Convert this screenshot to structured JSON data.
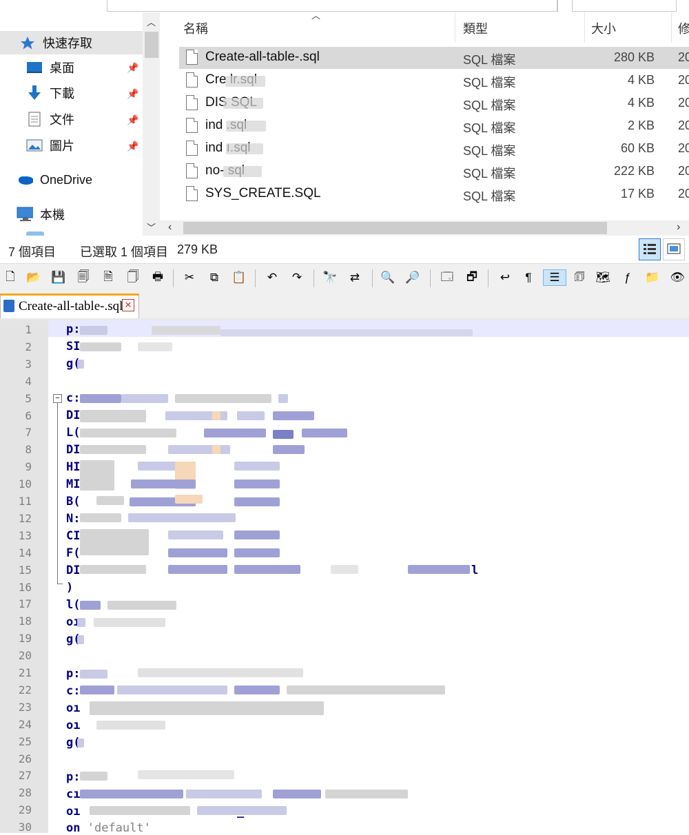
{
  "explorer": {
    "nav": {
      "items": [
        {
          "label": "快速存取",
          "icon": "quick-access-star-icon",
          "pinned": false
        },
        {
          "label": "桌面",
          "icon": "desktop-icon",
          "pinned": true
        },
        {
          "label": "下載",
          "icon": "download-arrow-icon",
          "pinned": true
        },
        {
          "label": "文件",
          "icon": "documents-icon",
          "pinned": true
        },
        {
          "label": "圖片",
          "icon": "pictures-icon",
          "pinned": true
        },
        {
          "label": "OneDrive",
          "icon": "onedrive-cloud-icon",
          "pinned": false
        },
        {
          "label": "本機",
          "icon": "this-pc-icon",
          "pinned": false
        }
      ]
    },
    "columns": {
      "name": "名稱",
      "type": "類型",
      "size": "大小",
      "modified": "修"
    },
    "files": [
      {
        "name": "Create-all-table-.sql",
        "type": "SQL 檔案",
        "size": "280 KB",
        "modified": "20",
        "selected": true
      },
      {
        "name": "Cre        lr.sql",
        "type": "SQL 檔案",
        "size": "4 KB",
        "modified": "20",
        "selected": false
      },
      {
        "name": "DIS        SQL",
        "type": "SQL 檔案",
        "size": "4 KB",
        "modified": "20",
        "selected": false
      },
      {
        "name": "ind        .sql",
        "type": "SQL 檔案",
        "size": "2 KB",
        "modified": "20",
        "selected": false
      },
      {
        "name": "ind        ı.sql",
        "type": "SQL 檔案",
        "size": "60 KB",
        "modified": "20",
        "selected": false
      },
      {
        "name": "no-       sql",
        "type": "SQL 檔案",
        "size": "222 KB",
        "modified": "20",
        "selected": false
      },
      {
        "name": "SYS_CREATE.SQL",
        "type": "SQL 檔案",
        "size": "17 KB",
        "modified": "20",
        "selected": false
      }
    ],
    "status": {
      "count": "7 個項目",
      "selection": "已選取 1 個項目",
      "selection_size": "279 KB"
    }
  },
  "editor": {
    "tab_label": "Create-all-table-.sql",
    "line_numbers": [
      "1",
      "2",
      "3",
      "4",
      "5",
      "6",
      "7",
      "8",
      "9",
      "10",
      "11",
      "12",
      "13",
      "14",
      "15",
      "16",
      "17",
      "18",
      "19",
      "20",
      "21",
      "22",
      "23",
      "24",
      "25",
      "26",
      "27",
      "28",
      "29",
      "30"
    ],
    "visible_code": {
      "l1": "p:",
      "l2": "SI",
      "l3": "g(",
      "l5": "c:",
      "l6": "DI",
      "l7": "L(",
      "l8": "DI",
      "l9": "HI",
      "l10": "MI",
      "l11": "B(",
      "l12": "N:",
      "l13": "CI",
      "l14": "F(",
      "l15": "DI",
      "l15_end": "l",
      "l16": ")",
      "l17": "l(",
      "l18": "oı",
      "l19": "g(",
      "l21": "p:",
      "l22": "c:",
      "l23": "oı",
      "l24": "oı",
      "l25": "g(",
      "l27": "p:",
      "l28": "cı",
      "l29": "oı",
      "l29_end": "_",
      "l30_kw": "on",
      "l30_str": "'default'"
    }
  }
}
